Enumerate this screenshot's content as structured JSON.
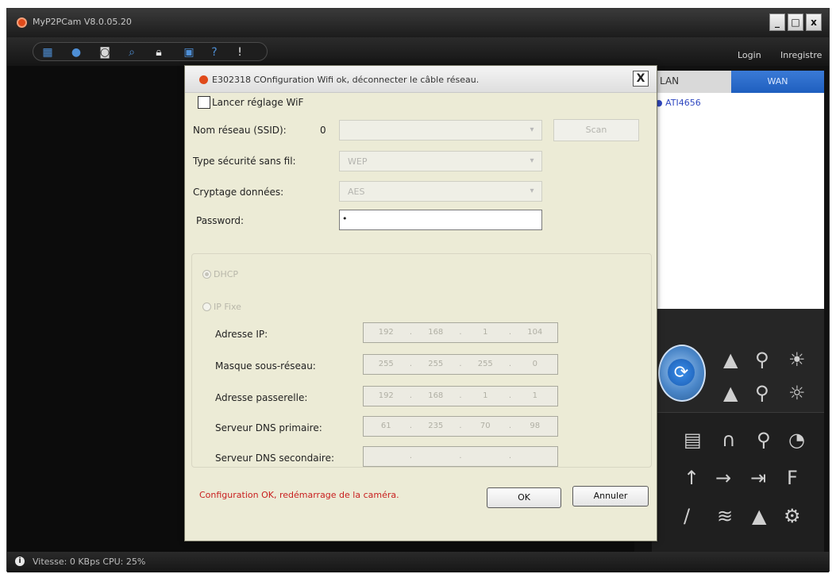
{
  "app": {
    "title": "MyP2PCam  V8.0.05.20",
    "window_controls": {
      "minimize": "_",
      "maximize": "□",
      "close": "x"
    },
    "toolbar_icons": [
      "grid-icon",
      "camera-icon",
      "snapshot-icon",
      "search-icon",
      "lock-icon",
      "save-icon",
      "help-icon",
      "info-icon"
    ],
    "top_links": {
      "login": "Login",
      "register": "Inregistre"
    }
  },
  "right_panel": {
    "tabs": {
      "lan": "LAN",
      "wan": "WAN"
    },
    "devices": [
      "ATI4656"
    ]
  },
  "status_bar": {
    "text": "Vitesse: 0 KBps  CPU: 25%"
  },
  "dialog": {
    "title": "E302318  COnfiguration Wifi ok, déconnecter le câble réseau.",
    "close": "X",
    "enable_wifi_label": "Lancer réglage WiF",
    "ssid_label": "Nom réseau (SSID):",
    "ssid_count": "0",
    "ssid_value": "",
    "scan_button": "Scan",
    "security_label": "Type sécurité sans fil:",
    "security_value": "WEP",
    "encryption_label": "Cryptage données:",
    "encryption_value": "AES",
    "password_label": "Password:",
    "password_value": "•",
    "dhcp_label": "DHCP",
    "static_ip_label": "IP Fixe",
    "ip_label": "Adresse IP:",
    "ip": [
      "192",
      "168",
      "1",
      "104"
    ],
    "mask_label": "Masque sous-réseau:",
    "mask": [
      "255",
      "255",
      "255",
      "0"
    ],
    "gateway_label": "Adresse passerelle:",
    "gateway": [
      "192",
      "168",
      "1",
      "1"
    ],
    "dns1_label": "Serveur DNS primaire:",
    "dns1": [
      "61",
      "235",
      "70",
      "98"
    ],
    "dns2_label": "Serveur DNS secondaire:",
    "dns2": [
      "",
      "",
      "",
      ""
    ],
    "status_message": "Configuration OK, redémarrage de la caméra.",
    "ok_button": "OK",
    "cancel_button": "Annuler"
  }
}
